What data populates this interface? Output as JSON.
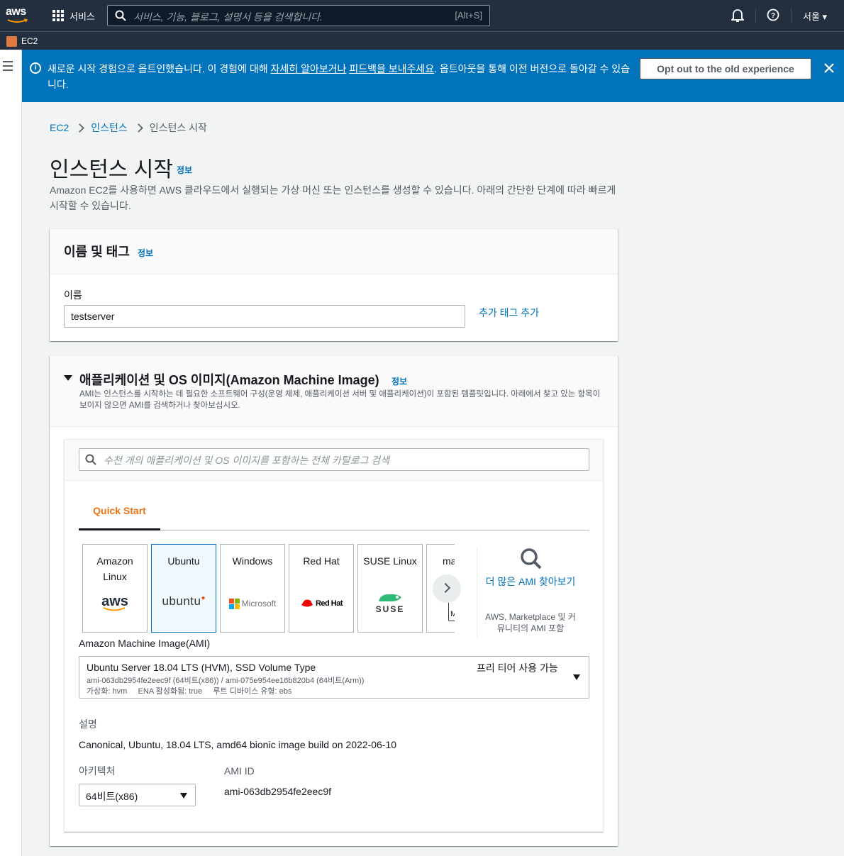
{
  "topnav": {
    "logo_text": "aws",
    "services_label": "서비스",
    "search_placeholder": "서비스, 기능, 블로그, 설명서 등을 검색합니다.",
    "search_shortcut": "[Alt+S]",
    "region_label": "서울 ▾",
    "icons": [
      "apps-grid-icon",
      "search-icon",
      "bell-icon",
      "help-icon"
    ]
  },
  "subnav": {
    "service_label": "EC2",
    "service_icon": "ec2-icon",
    "service_color": "#e07941"
  },
  "flash": {
    "msg_part1": "새로운 시작 경험으로 옵트인했습니다. 이 경험에 대해 ",
    "link_learn": "자세히 알아보거나",
    "msg_part2": " ",
    "link_feedback": "피드백을 보내주세요",
    "msg_part3": ". 옵트아웃을 통해 이전 버전으로 돌아갈 수 있습니다.",
    "optout_label": "Opt out to the old experience",
    "bg_color": "#0073bb"
  },
  "breadcrumb": {
    "items": [
      "EC2",
      "인스턴스",
      "인스턴스 시작"
    ]
  },
  "page": {
    "title": "인스턴스 시작",
    "info_label": "정보",
    "description": "Amazon EC2를 사용하면 AWS 클라우드에서 실행되는 가상 머신 또는 인스턴스를 생성할 수 있습니다. 아래의 간단한 단계에 따라 빠르게 시작할 수 있습니다."
  },
  "name_panel": {
    "title": "이름 및 태그",
    "info_label": "정보",
    "name_label": "이름",
    "name_value": "testserver",
    "add_tag_label": "추가 태그 추가"
  },
  "ami_panel": {
    "title": "애플리케이션 및 OS 이미지(Amazon Machine Image)",
    "info_label": "정보",
    "description": "AMI는 인스턴스를 시작하는 데 필요한 소프트웨어 구성(운영 체제, 애플리케이션 서버 및 애플리케이션)이 포함된 템플릿입니다. 아래에서 찾고 있는 항목이 보이지 않으면 AMI를 검색하거나 찾아보십시오.",
    "search_placeholder": "수천 개의 애플리케이션 및 OS 이미지를 포함하는 전체 카탈로그 검색",
    "tab_label": "Quick Start",
    "tab_color": "#ec7211",
    "tiles": [
      {
        "name": "Amazon Linux",
        "logo": "aws"
      },
      {
        "name": "Ubuntu",
        "logo": "ubuntu",
        "selected": true
      },
      {
        "name": "Windows",
        "logo": "Microsoft"
      },
      {
        "name": "Red Hat",
        "logo": "Red Hat"
      },
      {
        "name": "SUSE Linux",
        "logo": "SUSE"
      },
      {
        "name": "ma",
        "logo": "M"
      }
    ],
    "more_link": "더 많은 AMI 찾아보기",
    "more_sub": "AWS, Marketplace 및 커뮤니티의 AMI 포함",
    "ami_label": "Amazon Machine Image(AMI)",
    "ami_name": "Ubuntu Server 18.04 LTS (HVM), SSD Volume Type",
    "ami_ids": "ami-063db2954fe2eec9f (64비트(x86)) / ami-075e954ee16b820b4 (64비트(Arm))",
    "ami_meta": "가상화: hvm     ENA 활성화됨: true     루트 디바이스 유형: ebs",
    "free_tier": "프리 티어 사용 가능",
    "desc_label": "설명",
    "desc_value": "Canonical, Ubuntu, 18.04 LTS, amd64 bionic image build on 2022-06-10",
    "arch_label": "아키텍처",
    "arch_value": "64비트(x86)",
    "amiid_label": "AMI ID",
    "amiid_value": "ami-063db2954fe2eec9f"
  }
}
